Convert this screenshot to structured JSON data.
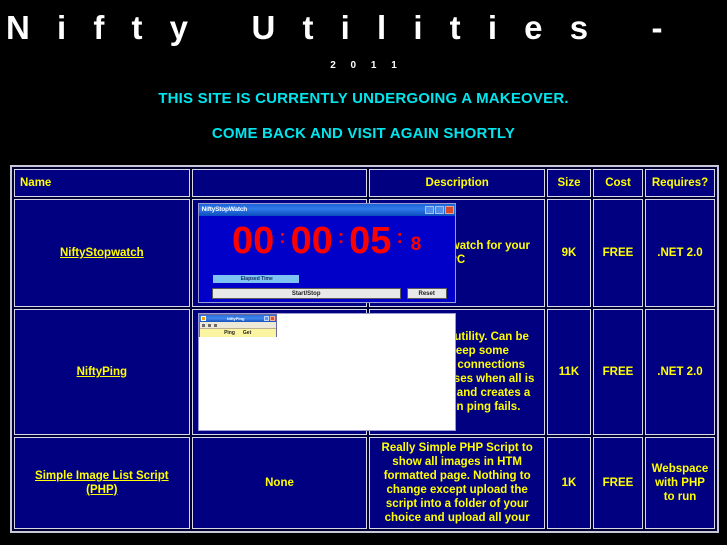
{
  "masthead": {
    "title": "N i f t y   U t i l i t i e s   -   U K",
    "year": "2 0 1 1",
    "notice_line_1": "THIS SITE IS CURRENTLY UNDERGOING A MAKEOVER.",
    "notice_line_2": "COME BACK AND VISIT AGAIN SHORTLY",
    "title_color": "#ffffff",
    "notice_color": "#00e5ee",
    "background_color": "#000000"
  },
  "table": {
    "accent_text_color": "#ffff00",
    "cell_background": "#000080",
    "border_color": "#d8d8e8",
    "headers": {
      "name": "Name",
      "screenshot": "",
      "description": "Description",
      "size": "Size",
      "cost": "Cost",
      "requires": "Requires?"
    },
    "rows": [
      {
        "name": "NiftyStopwatch",
        "screenshot_kind": "stopwatch-window",
        "description": "Simple Stopwatch for your PC",
        "size": "9K",
        "cost": "FREE",
        "requires": ".NET 2.0"
      },
      {
        "name": "NiftyPing",
        "screenshot_kind": "ping-window",
        "description": "Simple Ping utility. Can be used to keep some 'broadband' connections 'alive'. Minimises when all is OK. Pops-up and creates a fail log when ping fails.",
        "size": "11K",
        "cost": "FREE",
        "requires": ".NET 2.0"
      },
      {
        "name": "Simple Image List Script (PHP)",
        "screenshot_kind": "none",
        "screenshot_text": "None",
        "description": "Really Simple PHP Script to show all images in HTM formatted page. Nothing to change except upload the script into a folder of your choice and upload all your",
        "size": "1K",
        "cost": "FREE",
        "requires": "Webspace with PHP to run"
      }
    ]
  },
  "stopwatch_app": {
    "window_title": "NiftyStopWatch",
    "hours": "00",
    "minutes": "00",
    "seconds": "05",
    "tenths": "8",
    "separator": ":",
    "status_text": "Elapsed Time",
    "start_stop_label": "Start/Stop",
    "reset_label": "Reset",
    "digit_color": "#ff0000",
    "window_background": "#0000c8"
  },
  "ping_app": {
    "window_title": "NiftyPing",
    "tool_ping": "Ping",
    "tool_get": "Get",
    "toolbar_color": "#fbf4a0"
  }
}
